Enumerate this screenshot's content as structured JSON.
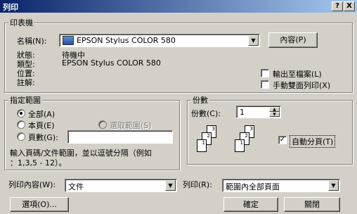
{
  "titlebar": {
    "title": "列印",
    "help": "?",
    "close": "X"
  },
  "printer": {
    "group_label": "印表機",
    "name_label": "名稱(N):",
    "name_value": "EPSON Stylus COLOR 580",
    "properties_btn": "內容(P)",
    "status_label": "狀態:",
    "status_value": "待機中",
    "type_label": "類型:",
    "type_value": "EPSON Stylus COLOR 580",
    "where_label": "位置:",
    "comment_label": "註解:",
    "print_to_file": "輸出至檔案(L)",
    "manual_duplex": "手動雙面列印(X)"
  },
  "range": {
    "group_label": "指定範圍",
    "all": "全部(A)",
    "current": "本頁(E)",
    "selection": "選取範圍(S)",
    "pages": "頁數(G):",
    "pages_value": "",
    "hint_line1": "輸入頁碼/文件範圍，並以逗號分隔（例如",
    "hint_line2": "：1,3,5 - 12）。"
  },
  "copies": {
    "group_label": "份數",
    "count_label": "份數(C):",
    "count_value": "1",
    "collate": "自動分頁(T)",
    "page_nums": [
      "3",
      "2",
      "1",
      "3",
      "2",
      "1"
    ]
  },
  "print_what": {
    "label": "列印內容(W):",
    "value": "文件"
  },
  "print_sel": {
    "label": "列印(R):",
    "value": "範圍內全部頁面"
  },
  "buttons": {
    "options": "選項(O)...",
    "ok": "確定",
    "cancel": "關閉"
  }
}
